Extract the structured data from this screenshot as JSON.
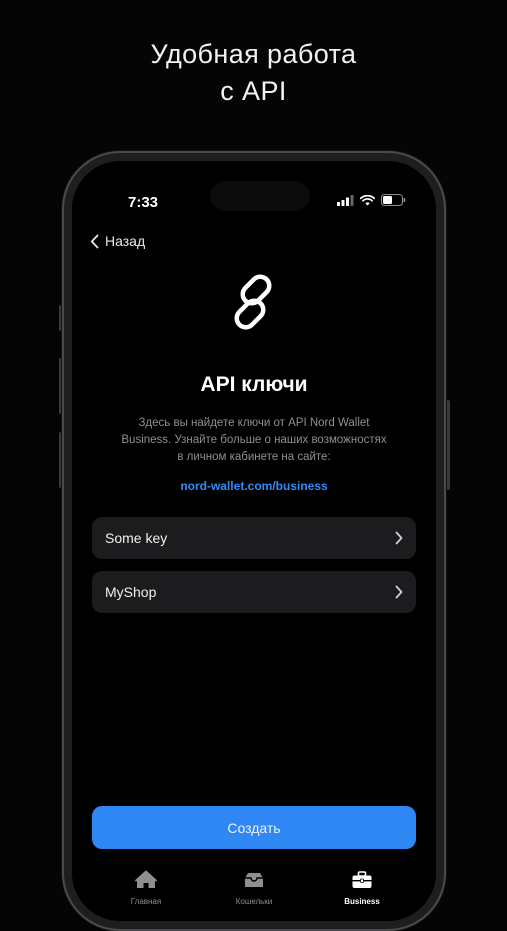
{
  "headline": {
    "line1": "Удобная работа",
    "line2": "с API"
  },
  "status_bar": {
    "time": "7:33"
  },
  "nav": {
    "back_label": "Назад"
  },
  "page": {
    "title": "API ключи",
    "description": [
      "Здесь вы найдете ключи от API Nord Wallet",
      "Business. Узнайте больше о наших возможностях",
      "в личном кабинете на сайте:"
    ],
    "link": "nord-wallet.com/business"
  },
  "keys": [
    {
      "name": "Some key"
    },
    {
      "name": "MyShop"
    }
  ],
  "actions": {
    "create_label": "Создать"
  },
  "tabs": [
    {
      "label": "Главная",
      "icon": "home-icon",
      "active": false
    },
    {
      "label": "Кошельки",
      "icon": "wallet-icon",
      "active": false
    },
    {
      "label": "Business",
      "icon": "briefcase-icon",
      "active": true
    }
  ],
  "colors": {
    "accent": "#2f87f4",
    "link": "#2f8cf5",
    "card": "#1c1c1e",
    "background": "#000000"
  }
}
